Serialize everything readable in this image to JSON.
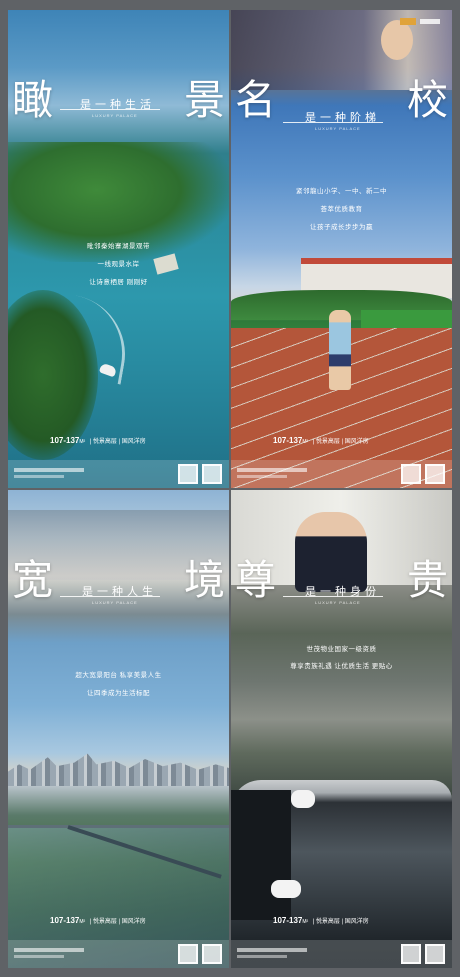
{
  "posters": [
    {
      "left_char": "瞰",
      "right_char": "景",
      "tagline": "是一种生活",
      "tagline_en": "LUXURY PALACE",
      "copy": [
        "毗邻秦始寨湖景观带",
        "一线观景水岸",
        "让诗意栖居 刚刚好"
      ],
      "spec_num": "107-137",
      "spec_unit": "M²",
      "spec_rest": "| 悦景高层 | 国风洋房"
    },
    {
      "left_char": "名",
      "right_char": "校",
      "tagline": "是一种阶梯",
      "tagline_en": "LUXURY PALACE",
      "copy": [
        "紧邻龍山小学、一中、新二中",
        "荟萃优质教育",
        "让孩子成长步步为赢"
      ],
      "spec_num": "107-137",
      "spec_unit": "M²",
      "spec_rest": "| 悦景高层 | 国风洋房"
    },
    {
      "left_char": "宽",
      "right_char": "境",
      "tagline": "是一种人生",
      "tagline_en": "LUXURY PALACE",
      "copy": [
        "超大宽景阳台 私享美景人生",
        "让四季成为生活标配"
      ],
      "spec_num": "107-137",
      "spec_unit": "M²",
      "spec_rest": "| 悦景高层 | 国风洋房"
    },
    {
      "left_char": "尊",
      "right_char": "贵",
      "tagline": "是一种身份",
      "tagline_en": "LUXURY PALACE",
      "copy": [
        "世茂物业国家一级资质",
        "尊享贵族礼遇  让优质生活 更贴心"
      ],
      "spec_num": "107-137",
      "spec_unit": "M²",
      "spec_rest": "| 悦景高层 | 国风洋房"
    }
  ]
}
